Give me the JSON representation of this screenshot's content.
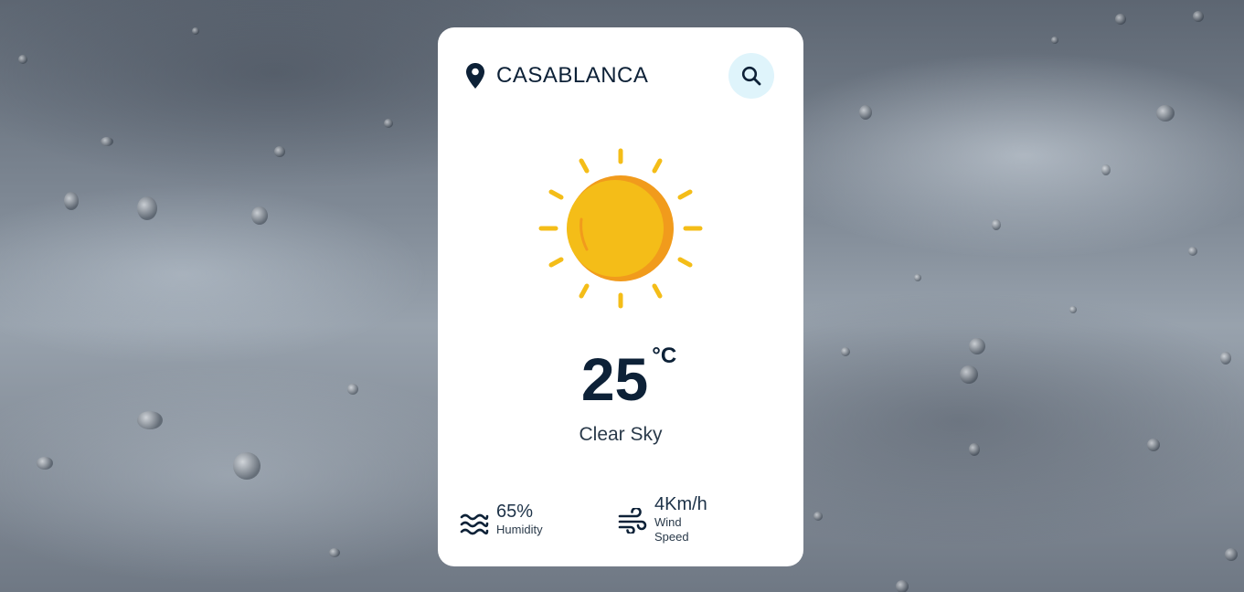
{
  "location": {
    "city": "CASABLANCA",
    "pin_icon": "location-pin-icon",
    "search_icon": "search-icon"
  },
  "weather": {
    "icon": "sun-icon",
    "temperature": "25",
    "unit": "°C",
    "description": "Clear Sky"
  },
  "details": {
    "humidity": {
      "value": "65%",
      "label": "Humidity",
      "icon": "humidity-waves-icon"
    },
    "wind": {
      "value": "4Km/h",
      "label": "Wind Speed",
      "icon": "wind-icon"
    }
  },
  "colors": {
    "text_dark": "#0d2137",
    "search_bg": "#dff4fb",
    "sun_yellow": "#f4bd18",
    "sun_orange": "#f19b1c"
  }
}
